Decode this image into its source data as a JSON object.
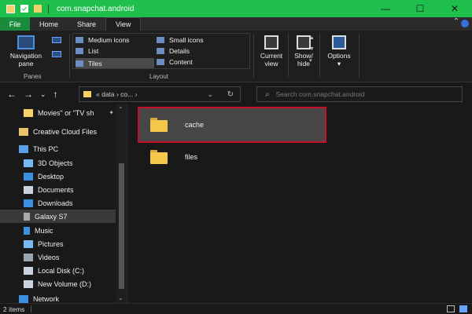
{
  "window": {
    "title": "com.snapchat.android",
    "minimize": "—",
    "maximize": "☐",
    "close": "✕",
    "accent": "#1ebf4c"
  },
  "ribbon": {
    "tabs": [
      {
        "label": "File"
      },
      {
        "label": "Home"
      },
      {
        "label": "Share"
      },
      {
        "label": "View"
      }
    ],
    "panes_group": {
      "nav_pane_label_1": "Navigation",
      "nav_pane_label_2": "pane",
      "label": "Panes"
    },
    "layout_group": {
      "label": "Layout",
      "items": [
        {
          "label": "Medium icons"
        },
        {
          "label": "Small icons"
        },
        {
          "label": "List"
        },
        {
          "label": "Details"
        },
        {
          "label": "Tiles"
        },
        {
          "label": "Content"
        }
      ]
    },
    "current_view": {
      "line1": "Current",
      "line2": "view"
    },
    "show_hide": {
      "line1": "Show/",
      "line2": "hide"
    },
    "options": {
      "label": "Options"
    }
  },
  "address": {
    "back": "←",
    "forward": "→",
    "recent": "⌄",
    "up": "↑",
    "path": "« data › co... ›",
    "search_placeholder": "Search com.snapchat.android"
  },
  "nav": {
    "items": [
      {
        "label": "Movies\" or \"TV sh"
      },
      {
        "label": "Creative Cloud Files"
      },
      {
        "label": "This PC"
      },
      {
        "label": "3D Objects"
      },
      {
        "label": "Desktop"
      },
      {
        "label": "Documents"
      },
      {
        "label": "Downloads"
      },
      {
        "label": "Galaxy S7"
      },
      {
        "label": "Music"
      },
      {
        "label": "Pictures"
      },
      {
        "label": "Videos"
      },
      {
        "label": "Local Disk (C:)"
      },
      {
        "label": "New Volume (D:)"
      },
      {
        "label": "Network"
      }
    ]
  },
  "files": [
    {
      "name": "cache"
    },
    {
      "name": "files"
    }
  ],
  "status": {
    "count": "2 items"
  }
}
